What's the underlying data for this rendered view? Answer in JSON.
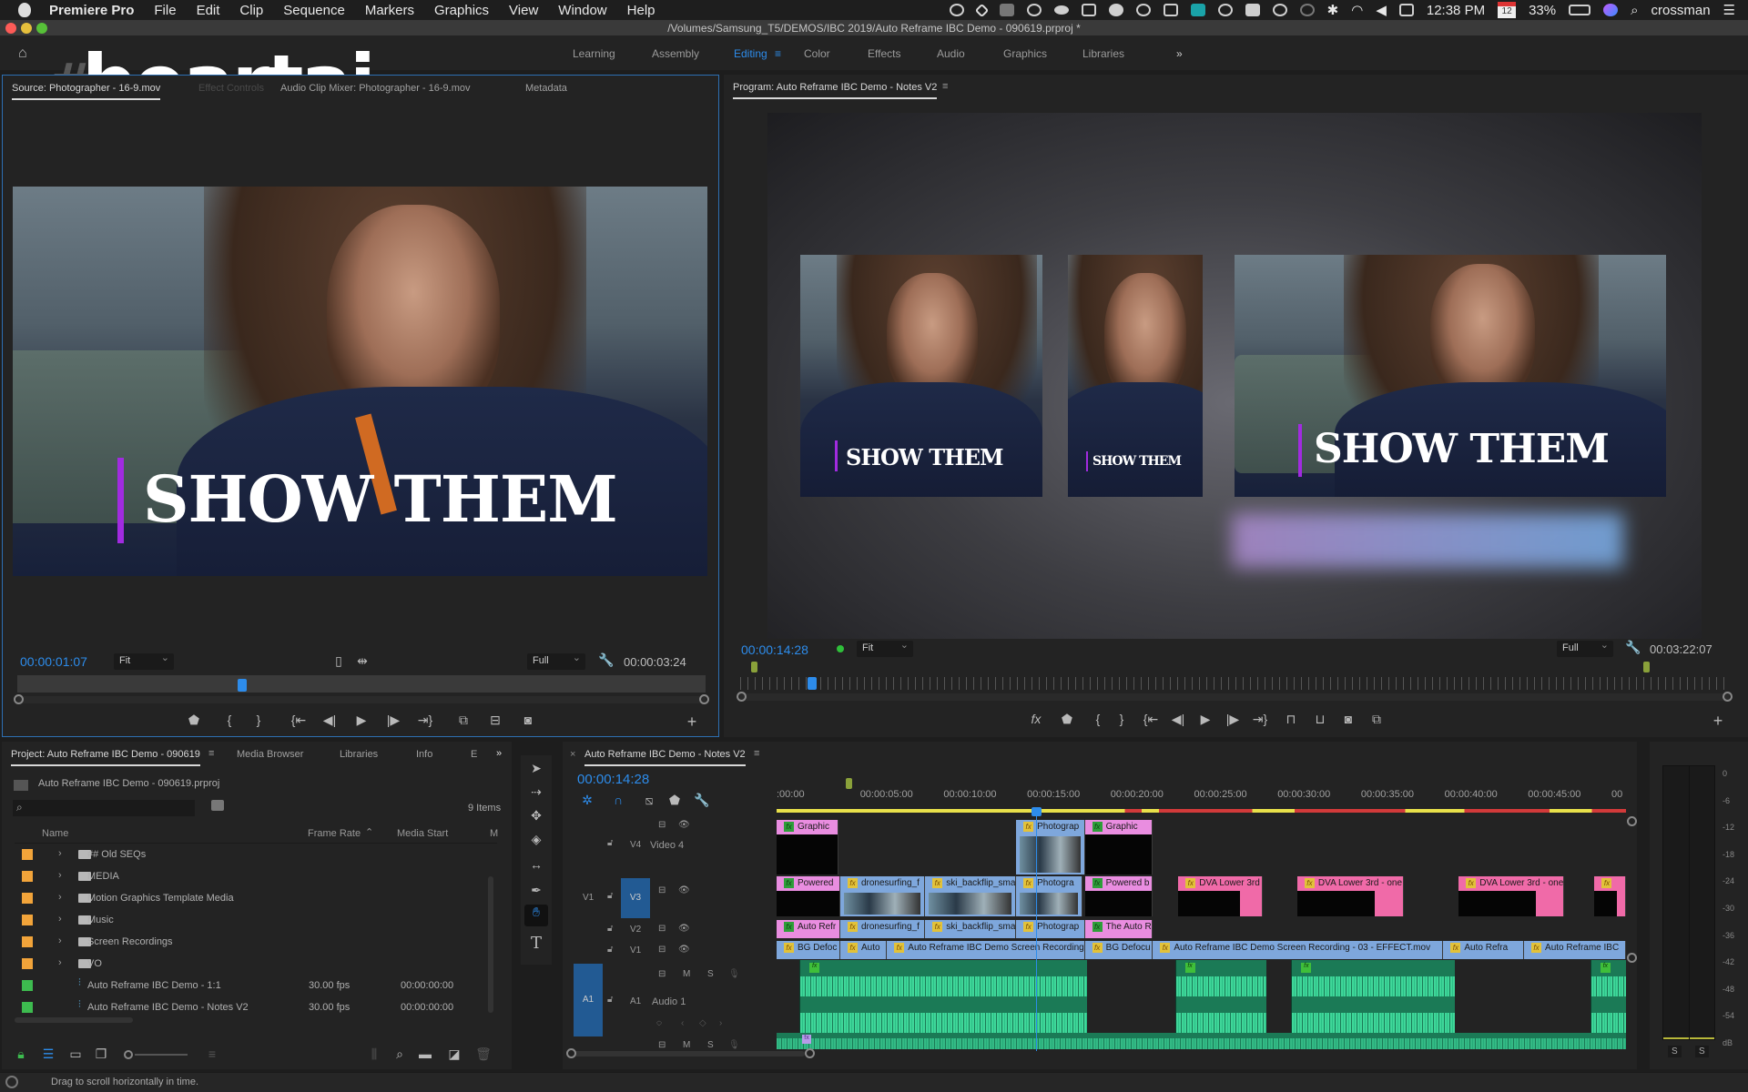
{
  "menubar": {
    "app_name": "Premiere Pro",
    "items": [
      "File",
      "Edit",
      "Clip",
      "Sequence",
      "Markers",
      "Graphics",
      "View",
      "Window",
      "Help"
    ],
    "status_icons": [
      "creative-cloud-sync-icon",
      "dropbox-icon",
      "app-icon",
      "creative-cloud-icon",
      "cloud-icon",
      "bluetooth-app-icon",
      "moon-icon",
      "clock-icon",
      "camera-icon",
      "cb-icon",
      "one-password-icon",
      "truck-icon",
      "time-machine-icon",
      "search-app-icon",
      "bluetooth-icon",
      "wifi-icon",
      "volume-icon",
      "calendar-widget-icon"
    ],
    "clock": "12:38 PM",
    "calendar_day": "12",
    "calendar_month": "SEP",
    "battery": "33%",
    "user": "crossman"
  },
  "titlebar": {
    "title": "/Volumes/Samsung_T5/DEMOS/IBC 2019/Auto Reframe IBC Demo - 090619.prproj *"
  },
  "watermark": {
    "text": "beartai",
    "hash": "#"
  },
  "workspaces": {
    "items": [
      "Learning",
      "Assembly",
      "Editing",
      "Color",
      "Effects",
      "Audio",
      "Graphics",
      "Libraries"
    ],
    "active": "Editing",
    "more": "»"
  },
  "source_panel": {
    "tabs": [
      "Source: Photographer - 16-9.mov",
      "Effect Controls",
      "Audio Clip Mixer: Photographer - 16-9.mov",
      "Metadata"
    ],
    "timecode": "00:00:01:07",
    "zoom": "Fit",
    "resolution": "Full",
    "duration": "00:00:03:24",
    "playhead_fraction": 0.32,
    "frame_title": "SHOW THEM"
  },
  "program_panel": {
    "title": "Program: Auto Reframe IBC Demo - Notes V2",
    "timecode": "00:00:14:28",
    "zoom": "Fit",
    "resolution": "Full",
    "duration": "00:03:22:07",
    "playhead_fraction": 0.068,
    "frames": [
      {
        "aspect": "1:1",
        "title": "SHOW THEM"
      },
      {
        "aspect": "9:16",
        "title": "SHOW THEM"
      },
      {
        "aspect": "16:9",
        "title": "SHOW THEM"
      }
    ]
  },
  "project_panel": {
    "tabs": [
      "Project: Auto Reframe IBC Demo - 090619",
      "Media Browser",
      "Libraries",
      "Info",
      "E"
    ],
    "more": "»",
    "file": "Auto Reframe IBC Demo - 090619.prproj",
    "search_placeholder": "",
    "item_count": "9 Items",
    "columns": [
      "Name",
      "Frame Rate",
      "Media Start",
      "M"
    ],
    "sort_indicator": "^",
    "rows": [
      {
        "type": "folder",
        "label_color": "#f2a43a",
        "name": "## Old SEQs",
        "frame_rate": "",
        "media_start": ""
      },
      {
        "type": "folder",
        "label_color": "#f2a43a",
        "name": "MEDIA",
        "frame_rate": "",
        "media_start": ""
      },
      {
        "type": "folder",
        "label_color": "#f2a43a",
        "name": "Motion Graphics Template Media",
        "frame_rate": "",
        "media_start": ""
      },
      {
        "type": "folder",
        "label_color": "#f2a43a",
        "name": "Music",
        "frame_rate": "",
        "media_start": ""
      },
      {
        "type": "folder",
        "label_color": "#f2a43a",
        "name": "Screen Recordings",
        "frame_rate": "",
        "media_start": ""
      },
      {
        "type": "folder",
        "label_color": "#f2a43a",
        "name": "VO",
        "frame_rate": "",
        "media_start": ""
      },
      {
        "type": "sequence",
        "label_color": "#3dbb4f",
        "name": "Auto Reframe IBC Demo - 1:1",
        "frame_rate": "30.00 fps",
        "media_start": "00:00:00:00"
      },
      {
        "type": "sequence",
        "label_color": "#3dbb4f",
        "name": "Auto Reframe IBC Demo - Notes V2",
        "frame_rate": "30.00 fps",
        "media_start": "00:00:00:00"
      }
    ]
  },
  "timeline": {
    "sequence_name": "Auto Reframe IBC Demo - Notes V2",
    "timecode": "00:00:14:28",
    "ruler": [
      ":00:00",
      "00:00:05:00",
      "00:00:10:00",
      "00:00:15:00",
      "00:00:20:00",
      "00:00:25:00",
      "00:00:30:00",
      "00:00:35:00",
      "00:00:40:00",
      "00:00:45:00",
      "00"
    ],
    "tracks": {
      "v4": {
        "id": "V4",
        "name": "Video 4",
        "clips": [
          {
            "label": "Graphic",
            "color": "pink",
            "start": 0.0,
            "end": 0.073
          },
          {
            "label": "Photograp",
            "color": "blue",
            "start": 0.282,
            "end": 0.363
          },
          {
            "label": "Graphic",
            "color": "pink",
            "start": 0.363,
            "end": 0.443
          }
        ]
      },
      "v3": {
        "id": "V3",
        "source": "V1",
        "clips": [
          {
            "label": "Powered",
            "color": "pink",
            "start": 0.0,
            "end": 0.075
          },
          {
            "label": "dronesurfing_f",
            "color": "blue",
            "start": 0.075,
            "end": 0.175
          },
          {
            "label": "ski_backflip_sma",
            "color": "blue",
            "start": 0.175,
            "end": 0.282
          },
          {
            "label": "Photogra",
            "color": "blue",
            "start": 0.282,
            "end": 0.36
          },
          {
            "label": "Powered b",
            "color": "pink",
            "start": 0.363,
            "end": 0.443
          },
          {
            "label": "DVA Lower 3rd",
            "color": "hotpink",
            "start": 0.473,
            "end": 0.572
          },
          {
            "label": "DVA Lower 3rd - one",
            "color": "hotpink",
            "start": 0.613,
            "end": 0.738
          },
          {
            "label": "DVA Lower 3rd - one",
            "color": "hotpink",
            "start": 0.803,
            "end": 0.927
          },
          {
            "label": "",
            "color": "hotpink",
            "start": 0.963,
            "end": 1.0
          }
        ]
      },
      "v2": {
        "id": "V2",
        "clips": [
          {
            "label": "Auto Refr",
            "color": "pink",
            "start": 0.0,
            "end": 0.075
          },
          {
            "label": "dronesurfing_f",
            "color": "blue",
            "start": 0.075,
            "end": 0.175
          },
          {
            "label": "ski_backflip_sma",
            "color": "blue",
            "start": 0.175,
            "end": 0.282
          },
          {
            "label": "Photograp",
            "color": "blue",
            "start": 0.282,
            "end": 0.363
          },
          {
            "label": "The Auto R",
            "color": "pink",
            "start": 0.363,
            "end": 0.443
          }
        ]
      },
      "v1": {
        "id": "V1",
        "clips": [
          {
            "label": "BG Defoc",
            "color": "blue",
            "start": 0.0,
            "end": 0.075
          },
          {
            "label": "Auto",
            "color": "blue",
            "start": 0.075,
            "end": 0.13
          },
          {
            "label": "Auto Reframe IBC Demo Screen Recording - 0",
            "color": "blue",
            "start": 0.13,
            "end": 0.363
          },
          {
            "label": "BG Defocu",
            "color": "blue",
            "start": 0.363,
            "end": 0.443
          },
          {
            "label": "Auto Reframe IBC Demo Screen Recording - 03 - EFFECT.mov",
            "color": "blue",
            "start": 0.443,
            "end": 0.785
          },
          {
            "label": "Auto Refra",
            "color": "blue",
            "start": 0.785,
            "end": 0.88
          },
          {
            "label": "Auto Reframe IBC",
            "color": "blue",
            "start": 0.88,
            "end": 1.0
          }
        ]
      },
      "a1": {
        "id": "A1",
        "source": "A1",
        "name": "Audio 1",
        "buttons": [
          "M",
          "S"
        ],
        "segments": [
          [
            0.027,
            0.366
          ],
          [
            0.469,
            0.577
          ],
          [
            0.606,
            0.798
          ],
          [
            0.958,
            1.0
          ]
        ]
      },
      "a2": {
        "buttons": [
          "M",
          "S"
        ]
      }
    },
    "tools": [
      "selection-tool",
      "track-select-tool",
      "ripple-edit-tool",
      "razor-tool",
      "slip-tool",
      "pen-tool",
      "hand-tool",
      "type-tool"
    ],
    "active_tool": "hand-tool"
  },
  "audio_meter": {
    "scale": [
      "0",
      "-6",
      "-12",
      "-18",
      "-24",
      "-30",
      "-36",
      "-42",
      "-48",
      "-54",
      "dB"
    ],
    "solo_labels": [
      "S",
      "S"
    ]
  },
  "status_bar": {
    "message": "Drag to scroll horizontally in time."
  }
}
